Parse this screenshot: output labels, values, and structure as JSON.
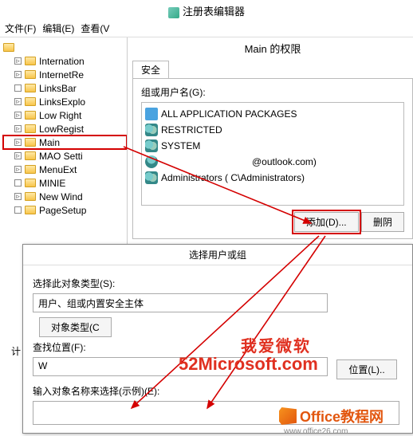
{
  "regedit": {
    "title": "注册表编辑器",
    "menu": {
      "file": "文件(F)",
      "edit": "编辑(E)",
      "view": "查看(V"
    },
    "tree": [
      "Internation",
      "InternetRe",
      "LinksBar",
      "LinksExplo",
      "Low Right",
      "LowRegist",
      "Main",
      "MAO Setti",
      "MenuExt",
      "MINIE",
      "New Wind",
      "PageSetup"
    ]
  },
  "perm": {
    "title": "Main 的权限",
    "tab": "安全",
    "group_label": "组或用户名(G):",
    "items": {
      "pkg": "ALL APPLICATION PACKAGES",
      "restricted": "RESTRICTED",
      "system": "SYSTEM",
      "user": "@outlook.com)",
      "admins": "Administrators (                    C\\Administrators)"
    },
    "add_btn": "添加(D)...",
    "remove_btn": "删阴"
  },
  "dialog": {
    "title": "选择用户或组",
    "obj_type_label": "选择此对象类型(S):",
    "obj_type_value": "用户、组或内置安全主体",
    "obj_type_btn": "对象类型(C",
    "loc_label": "查找位置(F):",
    "loc_value": "W",
    "loc_btn": "位置(L)..",
    "name_label": "输入对象名称来选择(示例)(E):"
  },
  "sidebar_letter": "计",
  "watermark": {
    "line1": "我爱微软",
    "line2": "52Microsoft.com",
    "footer": "Office教程网",
    "url": "www.office26.com"
  }
}
